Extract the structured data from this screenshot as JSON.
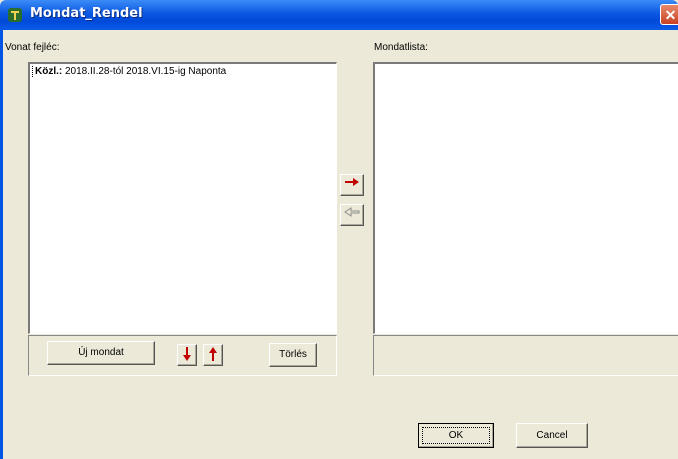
{
  "window": {
    "title": "Mondat_Rendel",
    "close_glyph": "✕",
    "icon": "app-icon"
  },
  "left": {
    "label": "Vonat fejléc:",
    "items": [
      {
        "prefix": "Közl.:",
        "text": "2018.II.28-tól 2018.VI.15-ig Naponta"
      }
    ],
    "new_button": "Új mondat",
    "down_icon": "arrow-down-icon",
    "up_icon": "arrow-up-icon",
    "delete_button": "Törlés"
  },
  "middle": {
    "add_icon": "arrow-right-icon",
    "remove_icon": "arrow-left-icon"
  },
  "right": {
    "label": "Mondatlista:"
  },
  "footer": {
    "ok_button": "OK",
    "cancel_button": "Cancel"
  },
  "colors": {
    "arrow_red": "#c00000",
    "titlebar_blue": "#0a58e2",
    "dialog_bg": "#ece9d8"
  }
}
